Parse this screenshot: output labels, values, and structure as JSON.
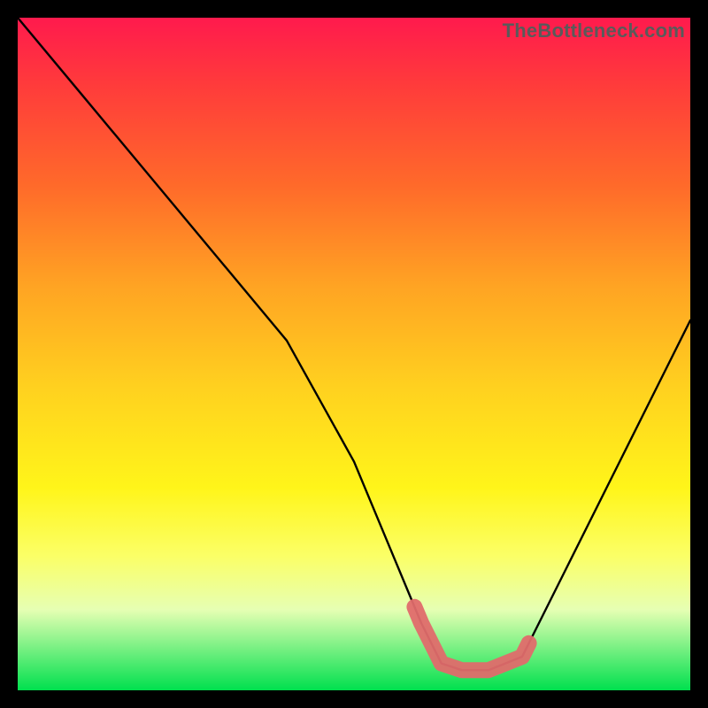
{
  "watermark": "TheBottleneck.com",
  "chart_data": {
    "type": "line",
    "title": "",
    "xlabel": "",
    "ylabel": "",
    "xlim": [
      0,
      100
    ],
    "ylim": [
      0,
      100
    ],
    "series": [
      {
        "name": "bottleneck-curve",
        "x": [
          0,
          10,
          20,
          30,
          40,
          50,
          55,
          60,
          63,
          66,
          70,
          75,
          80,
          90,
          100
        ],
        "values": [
          100,
          88,
          76,
          64,
          52,
          34,
          22,
          10,
          4,
          3,
          3,
          5,
          15,
          35,
          55
        ]
      }
    ],
    "highlight": {
      "name": "optimal-zone",
      "x_range": [
        59,
        76
      ],
      "band_y": 4
    },
    "colors": {
      "curve": "#000000",
      "highlight": "#e06b6b",
      "gradient_top": "#ff1a4d",
      "gradient_bottom": "#00e04e"
    }
  }
}
